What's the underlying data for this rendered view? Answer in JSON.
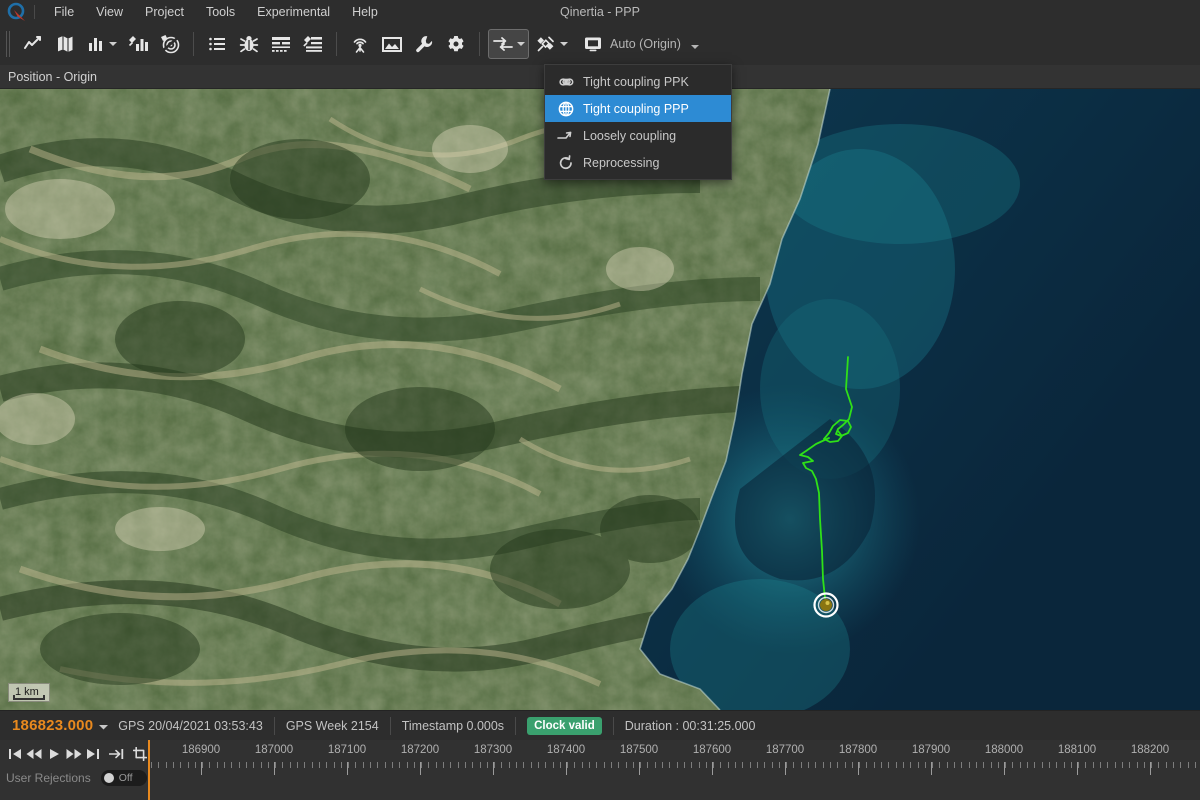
{
  "window": {
    "title": "Qinertia - PPP",
    "logo_icon": "qinertia-compass-logo"
  },
  "menubar": {
    "items": [
      {
        "label": "File"
      },
      {
        "label": "View"
      },
      {
        "label": "Project"
      },
      {
        "label": "Tools"
      },
      {
        "label": "Experimental"
      },
      {
        "label": "Help"
      }
    ]
  },
  "toolbar": {
    "groups": [
      {
        "buttons": [
          {
            "icon": "line-chart-icon",
            "name": "plot-view-button",
            "caret": false
          },
          {
            "icon": "map-icon",
            "name": "map-view-button",
            "caret": false
          },
          {
            "icon": "bar-chart-icon",
            "name": "bar-chart-button",
            "caret": true
          },
          {
            "icon": "satellite-bars-icon",
            "name": "satellite-status-button",
            "caret": false
          },
          {
            "icon": "radar-icon",
            "name": "radar-view-button",
            "caret": false
          }
        ]
      },
      {
        "buttons": [
          {
            "icon": "list-icon",
            "name": "list-view-button",
            "caret": false
          },
          {
            "icon": "bug-icon",
            "name": "debug-button",
            "caret": false
          },
          {
            "icon": "table-log-icon",
            "name": "log-table-button",
            "caret": false
          },
          {
            "icon": "satellite-log-icon",
            "name": "satellite-log-button",
            "caret": false
          }
        ]
      },
      {
        "buttons": [
          {
            "icon": "antenna-icon",
            "name": "antenna-button",
            "caret": false
          },
          {
            "icon": "image-icon",
            "name": "image-button",
            "caret": false
          },
          {
            "icon": "wrench-icon",
            "name": "tools-button",
            "caret": false
          },
          {
            "icon": "gear-icon",
            "name": "settings-button",
            "caret": false
          }
        ]
      },
      {
        "buttons": [
          {
            "icon": "coupling-arrows-icon",
            "name": "processing-mode-button",
            "caret": true,
            "active": true
          },
          {
            "icon": "satellite-icon",
            "name": "satellite-config-button",
            "caret": true
          }
        ]
      }
    ],
    "frame_combo": {
      "icon": "frame-icon",
      "label": "Auto (Origin)",
      "caret": true
    }
  },
  "processing_menu": {
    "open": true,
    "items": [
      {
        "icon": "infinity-icon",
        "label": "Tight coupling PPK",
        "selected": false
      },
      {
        "icon": "globe-icon",
        "label": "Tight coupling PPP",
        "selected": true
      },
      {
        "icon": "loose-arrow-icon",
        "label": "Loosely coupling",
        "selected": false
      },
      {
        "icon": "reload-icon",
        "label": "Reprocessing",
        "selected": false
      }
    ],
    "highlight_color": "#2d8bd4"
  },
  "view_header": {
    "title": "Position - Origin"
  },
  "map": {
    "scale_bar": "1 km",
    "track_color": "#2fe018",
    "marker": {
      "name": "current-position-marker",
      "ring_color": "#ffffff",
      "center_color": "#8a7512"
    },
    "ocean_color": "#0d2c42",
    "land_color": "#3e5b33"
  },
  "statusbar": {
    "time": "186823.000",
    "caret_icon": "chevron-down-icon",
    "gps_datetime": "GPS 20/04/2021 03:53:43",
    "gps_week": "GPS Week 2154",
    "timestamp": "Timestamp 0.000s",
    "clock_badge": "Clock valid",
    "clock_badge_color": "#3aa06e",
    "duration": "Duration : 00:31:25.000"
  },
  "timeline": {
    "transport": [
      {
        "icon": "skip-to-start-icon",
        "name": "skip-to-start-button"
      },
      {
        "icon": "rewind-icon",
        "name": "rewind-button"
      },
      {
        "icon": "play-icon",
        "name": "play-button"
      },
      {
        "icon": "fast-forward-icon",
        "name": "fast-forward-button"
      },
      {
        "icon": "skip-to-end-icon",
        "name": "skip-to-end-button"
      },
      {
        "icon": "jump-to-end-icon",
        "name": "jump-to-end-button"
      },
      {
        "icon": "crop-icon",
        "name": "crop-range-button"
      }
    ],
    "user_rejections": {
      "label": "User Rejections",
      "state": "Off"
    },
    "cursor_color": "#e8891e",
    "ticks": [
      "186900",
      "187000",
      "187100",
      "187200",
      "187300",
      "187400",
      "187500",
      "187600",
      "187700",
      "187800",
      "187900",
      "188000",
      "188100",
      "188200"
    ]
  }
}
